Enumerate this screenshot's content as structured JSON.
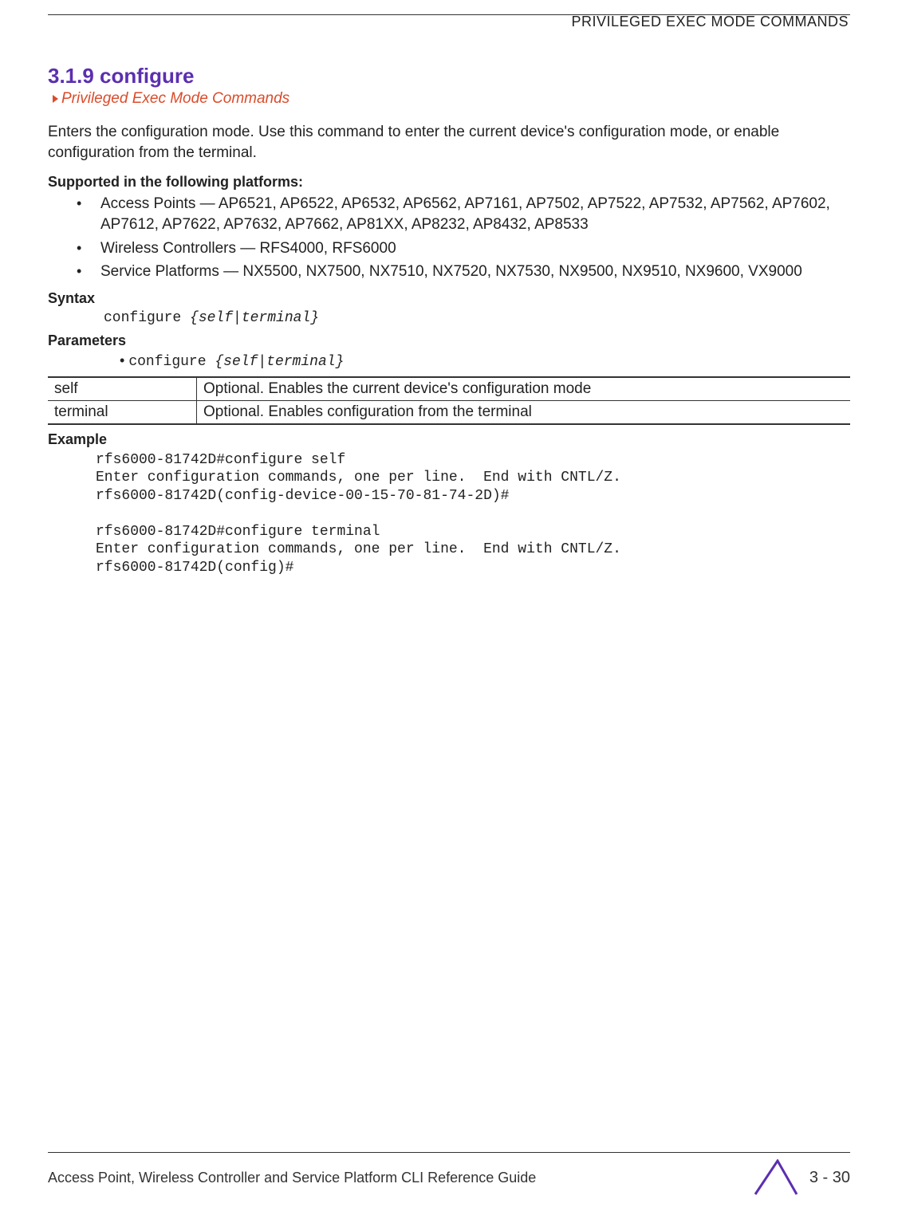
{
  "running_head": "PRIVILEGED EXEC MODE COMMANDS",
  "section": {
    "number_title": "3.1.9 configure",
    "breadcrumb": "Privileged Exec Mode Commands",
    "intro": "Enters the configuration mode. Use this command to enter the current device's configuration mode, or enable configuration from the terminal."
  },
  "supported": {
    "heading": "Supported in the following platforms:",
    "items": [
      "Access Points — AP6521, AP6522, AP6532, AP6562, AP7161, AP7502, AP7522, AP7532, AP7562, AP7602, AP7612, AP7622, AP7632, AP7662, AP81XX, AP8232, AP8432, AP8533",
      "Wireless Controllers — RFS4000, RFS6000",
      "Service Platforms — NX5500, NX7500, NX7510, NX7520, NX7530, NX9500, NX9510, NX9600, VX9000"
    ]
  },
  "syntax": {
    "heading": "Syntax",
    "cmd": "configure ",
    "args": "{self|terminal}"
  },
  "parameters": {
    "heading": "Parameters",
    "line_cmd": "configure ",
    "line_args": "{self|terminal}",
    "rows": [
      {
        "key": "self",
        "desc": "Optional. Enables the current device's configuration mode"
      },
      {
        "key": "terminal",
        "desc": "Optional. Enables configuration from the terminal"
      }
    ]
  },
  "example": {
    "heading": "Example",
    "text": "rfs6000-81742D#configure self\nEnter configuration commands, one per line.  End with CNTL/Z.\nrfs6000-81742D(config-device-00-15-70-81-74-2D)#\n\nrfs6000-81742D#configure terminal\nEnter configuration commands, one per line.  End with CNTL/Z.\nrfs6000-81742D(config)#"
  },
  "footer": {
    "guide": "Access Point, Wireless Controller and Service Platform CLI Reference Guide",
    "page": "3 - 30"
  }
}
